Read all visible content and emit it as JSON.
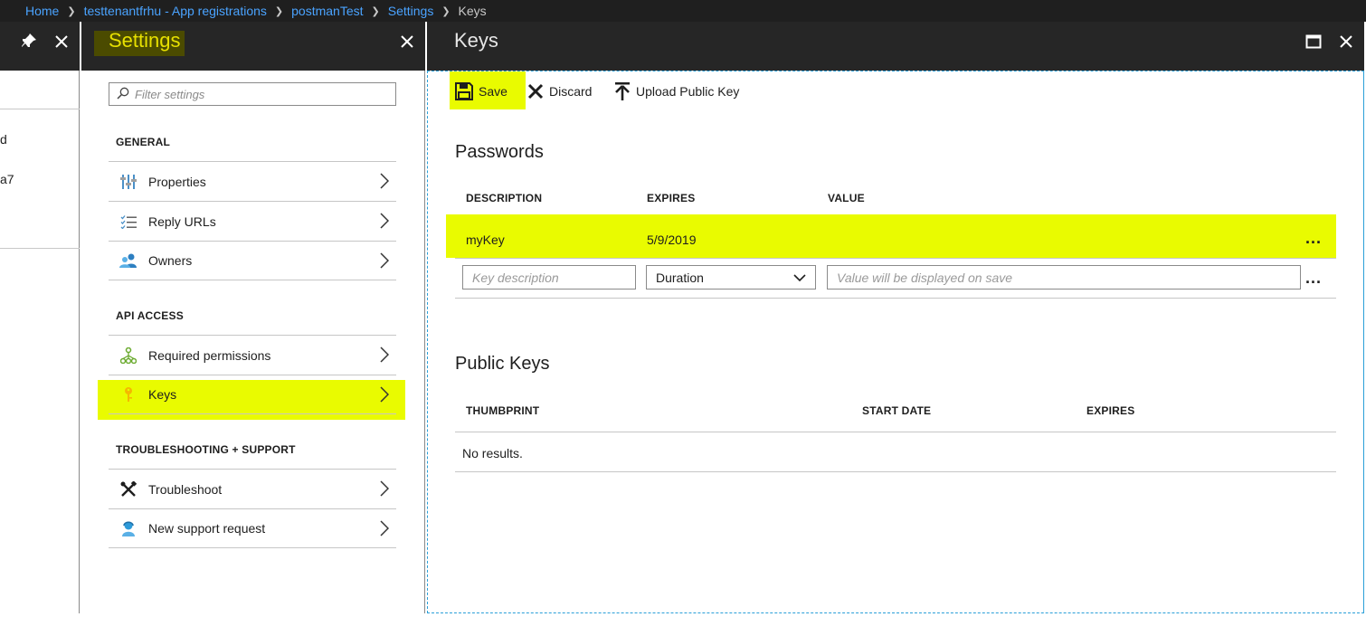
{
  "breadcrumb": [
    {
      "label": "Home"
    },
    {
      "label": "testtenantfrhu - App registrations"
    },
    {
      "label": "postmanTest"
    },
    {
      "label": "Settings"
    },
    {
      "label": "Keys"
    }
  ],
  "left_blade": {
    "text_1": "d",
    "text_2": "a7"
  },
  "settings_blade": {
    "title": "Settings",
    "filter_placeholder": "Filter settings",
    "sections": [
      {
        "label": "GENERAL",
        "items": [
          {
            "label": "Properties",
            "icon": "properties-icon"
          },
          {
            "label": "Reply URLs",
            "icon": "list-icon"
          },
          {
            "label": "Owners",
            "icon": "people-icon"
          }
        ]
      },
      {
        "label": "API ACCESS",
        "items": [
          {
            "label": "Required permissions",
            "icon": "hierarchy-icon"
          },
          {
            "label": "Keys",
            "icon": "key-icon"
          }
        ]
      },
      {
        "label": "TROUBLESHOOTING + SUPPORT",
        "items": [
          {
            "label": "Troubleshoot",
            "icon": "wrench-icon"
          },
          {
            "label": "New support request",
            "icon": "support-person-icon"
          }
        ]
      }
    ]
  },
  "keys_blade": {
    "title": "Keys",
    "toolbar": {
      "save_label": "Save",
      "discard_label": "Discard",
      "upload_label": "Upload Public Key"
    },
    "passwords": {
      "title": "Passwords",
      "columns": [
        "DESCRIPTION",
        "EXPIRES",
        "VALUE"
      ],
      "rows": [
        {
          "description": "myKey",
          "expires": "5/9/2019",
          "value": ""
        }
      ],
      "new_row": {
        "description_placeholder": "Key description",
        "duration_value": "Duration",
        "value_placeholder": "Value will be displayed on save"
      },
      "more_label": "..."
    },
    "public_keys": {
      "title": "Public Keys",
      "columns": [
        "THUMBPRINT",
        "START DATE",
        "EXPIRES"
      ],
      "empty_text": "No results."
    }
  },
  "colors": {
    "highlight": "#e9fb00",
    "link": "#4aa3ff",
    "header_bg": "#262626",
    "focus_border": "#2a9fd8"
  }
}
